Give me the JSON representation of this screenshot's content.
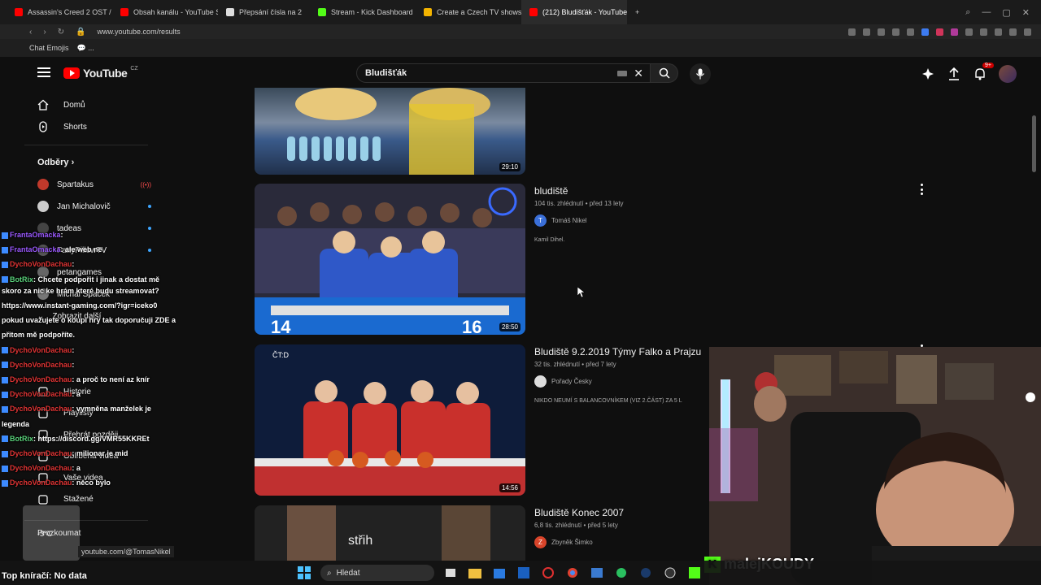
{
  "browser": {
    "tabs": [
      {
        "label": "Assassin's Creed 2 OST /",
        "color": "#ff0000"
      },
      {
        "label": "Obsah kanálu - YouTube S",
        "color": "#ff0000"
      },
      {
        "label": "Přepsání čísla na 2",
        "color": "#dddddd"
      },
      {
        "label": "Stream - Kick Dashboard",
        "color": "#53fc18"
      },
      {
        "label": "Create a Czech TV shows",
        "color": "#f4b400"
      },
      {
        "label": "(212) Bludišťák - YouTube",
        "color": "#ff0000",
        "active": true
      }
    ],
    "new_tab": "+",
    "url": "www.youtube.com/results",
    "bookmarks": [
      "Chat Emojis",
      "💬 ..."
    ]
  },
  "header": {
    "logo": "YouTube",
    "country": "CZ",
    "search_value": "Bludišťák",
    "clear": "✕",
    "notification_count": "9+"
  },
  "sidebar": {
    "items": [
      {
        "label": "Domů",
        "icon": "home-icon"
      },
      {
        "label": "Shorts",
        "icon": "shorts-icon"
      }
    ],
    "subscriptions_heading": "Odběry",
    "subscriptions": [
      {
        "label": "Spartakus",
        "color": "#c0392b",
        "live": "((•))"
      },
      {
        "label": "Jan Michalovič",
        "color": "#cccccc"
      },
      {
        "label": "tadeas",
        "color": "#444444"
      },
      {
        "label": "FattyPillowTV",
        "color": "#555555"
      },
      {
        "label": "petangames",
        "color": "#666666"
      },
      {
        "label": "Michal Špaček",
        "color": "#777777"
      }
    ],
    "show_more": "Zobrazit další",
    "you_items": [
      {
        "label": "Historie",
        "icon": "history-icon"
      },
      {
        "label": "Playlisty",
        "icon": "playlist-icon"
      },
      {
        "label": "Přehrát později",
        "icon": "watch-later-icon"
      },
      {
        "label": "Oblíbená videa",
        "icon": "like-icon"
      },
      {
        "label": "Vaše videa",
        "icon": "your-videos-icon"
      },
      {
        "label": "Stažené",
        "icon": "download-icon"
      }
    ],
    "explore": "Prozkoumat"
  },
  "results": [
    {
      "title": "",
      "meta": "",
      "channel": "",
      "desc": "",
      "duration": "29:10"
    },
    {
      "title": "bludiště",
      "meta": "104 tis. zhlédnutí • před 13 lety",
      "channel": "Tomáš Nikel",
      "channel_initial": "T",
      "channel_color": "#3a6fd8",
      "desc": "Kamil Dihel.",
      "duration": "28:50"
    },
    {
      "title": "Bludiště 9.2.2019 Týmy Falko a Prajzu",
      "meta": "32 tis. zhlédnutí • před 7 lety",
      "channel": "Pořady Česky",
      "channel_initial": "",
      "channel_color": "#dddddd",
      "desc": "NIKDO NEUMÍ S BALANCOVNÍKEM (VIZ 2.ČÁST) ZA 5 L",
      "duration": "14:56"
    },
    {
      "title": "Bludiště Konec 2007",
      "meta": "6,8 tis. zhlédnutí • před 5 lety",
      "channel": "Zbyněk Šimko",
      "channel_initial": "Z",
      "channel_color": "#d8442a",
      "desc": "",
      "duration": ""
    }
  ],
  "chat": [
    {
      "user": "FrantaOmacka",
      "text": ":",
      "color": "g"
    },
    {
      "user": "FrantaOmacka",
      "text": ": ale web ne",
      "color": "g"
    },
    {
      "user": "DychoVonDachau",
      "text": ":",
      "color": "r"
    },
    {
      "user": "BotRix",
      "text": ": Chcete podpořit i jinak a dostat mě",
      "color": "b"
    },
    {
      "user": "",
      "text": "skoro za nic ke hrám které budu streamovat?",
      "color": ""
    },
    {
      "user": "",
      "text": "https://www.instant-gaming.com/?igr=iceko0",
      "color": ""
    },
    {
      "user": "",
      "text": "pokud uvažujete o koupi hry tak doporučuji ZDE a",
      "color": ""
    },
    {
      "user": "",
      "text": "přitom mě podpoříte.",
      "color": ""
    },
    {
      "user": "DychoVonDachau",
      "text": ":",
      "color": "r"
    },
    {
      "user": "DychoVonDachau",
      "text": ":",
      "color": "r"
    },
    {
      "user": "DychoVonDachau",
      "text": ": a proč to není az knír",
      "color": "r"
    },
    {
      "user": "DychoVonDachau",
      "text": ": a",
      "color": "r"
    },
    {
      "user": "DychoVonDachau",
      "text": ": vymněna manželek je",
      "color": "r"
    },
    {
      "user": "",
      "text": "legenda",
      "color": ""
    },
    {
      "user": "BotRix",
      "text": ": https://discord.gg/VMR55KKREt",
      "color": "b"
    },
    {
      "user": "DychoVonDachau",
      "text": ": milionar je mid",
      "color": "r"
    },
    {
      "user": "DychoVonDachau",
      "text": ": a",
      "color": "r"
    },
    {
      "user": "DychoVonDachau",
      "text": ": něco bylo",
      "color": "r"
    }
  ],
  "overlay": {
    "streamer_name": "malejKOUDY",
    "kick_letter": "K",
    "status": "Top kníračí: No data",
    "url_hint": "youtube.com/@TomasNikel",
    "weather_temp": "-3°C"
  },
  "taskbar": {
    "search_label": "Hledat"
  }
}
